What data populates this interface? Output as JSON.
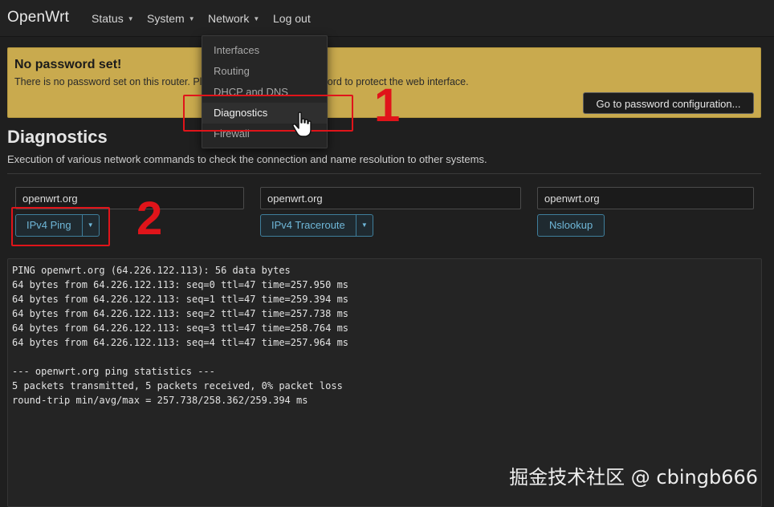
{
  "navbar": {
    "brand": "OpenWrt",
    "items": [
      {
        "label": "Status"
      },
      {
        "label": "System"
      },
      {
        "label": "Network"
      },
      {
        "label": "Log out"
      }
    ]
  },
  "network_menu": {
    "items": [
      {
        "label": "Interfaces"
      },
      {
        "label": "Routing"
      },
      {
        "label": "DHCP and DNS"
      },
      {
        "label": "Diagnostics",
        "active": true
      },
      {
        "label": "Firewall"
      }
    ]
  },
  "alert": {
    "title": "No password set!",
    "text": "There is no password set on this router. Please configure a root password to protect the web interface.",
    "button_label": "Go to password configuration..."
  },
  "page": {
    "title": "Diagnostics",
    "description": "Execution of various network commands to check the connection and name resolution to other systems."
  },
  "tools": {
    "ping": {
      "host_value": "openwrt.org",
      "button_label": "IPv4 Ping"
    },
    "traceroute": {
      "host_value": "openwrt.org",
      "button_label": "IPv4 Traceroute"
    },
    "nslookup": {
      "host_value": "openwrt.org",
      "button_label": "Nslookup"
    }
  },
  "output": {
    "lines": [
      "PING openwrt.org (64.226.122.113): 56 data bytes",
      "64 bytes from 64.226.122.113: seq=0 ttl=47 time=257.950 ms",
      "64 bytes from 64.226.122.113: seq=1 ttl=47 time=259.394 ms",
      "64 bytes from 64.226.122.113: seq=2 ttl=47 time=257.738 ms",
      "64 bytes from 64.226.122.113: seq=3 ttl=47 time=258.764 ms",
      "64 bytes from 64.226.122.113: seq=4 ttl=47 time=257.964 ms",
      "",
      "--- openwrt.org ping statistics ---",
      "5 packets transmitted, 5 packets received, 0% packet loss",
      "round-trip min/avg/max = 257.738/258.362/259.394 ms"
    ]
  },
  "annotations": {
    "step1": "1",
    "step2": "2",
    "color": "#e0141a"
  },
  "watermark": "掘金技术社区 @ cbingb666",
  "colors": {
    "alert_background": "#c9aa4e",
    "button_accent": "#6fb7d8",
    "page_background": "#1f1f1f"
  },
  "icons": {
    "caret": "caret-down-icon",
    "cursor": "hand-pointer-icon"
  }
}
